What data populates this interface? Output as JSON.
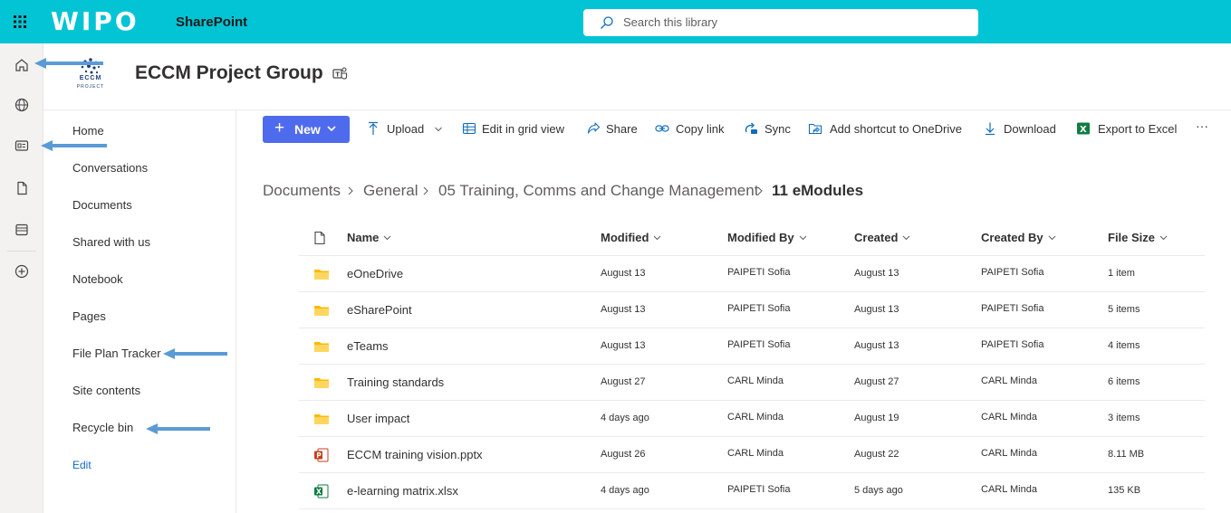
{
  "topbar": {
    "brand": "WIPO",
    "app_name": "SharePoint",
    "search_placeholder": "Search this library",
    "bg_color": "#03c4d4"
  },
  "rail": {
    "items": [
      {
        "icon": "home-icon"
      },
      {
        "icon": "globe-icon"
      },
      {
        "icon": "news-icon"
      },
      {
        "icon": "file-icon"
      },
      {
        "icon": "lists-icon"
      },
      {
        "icon": "add-icon"
      }
    ]
  },
  "site": {
    "title": "ECCM Project Group",
    "logo_text": "ECCM",
    "logo_subtext": "PROJECT"
  },
  "nav": {
    "items": [
      {
        "label": "Home"
      },
      {
        "label": "Conversations"
      },
      {
        "label": "Documents"
      },
      {
        "label": "Shared with us"
      },
      {
        "label": "Notebook"
      },
      {
        "label": "Pages"
      },
      {
        "label": "File Plan Tracker"
      },
      {
        "label": "Site contents"
      },
      {
        "label": "Recycle bin"
      }
    ],
    "edit_label": "Edit"
  },
  "commandbar": {
    "new_label": "New",
    "upload_label": "Upload",
    "edit_grid_label": "Edit in grid view",
    "share_label": "Share",
    "copy_link_label": "Copy link",
    "sync_label": "Sync",
    "add_shortcut_label": "Add shortcut to OneDrive",
    "download_label": "Download",
    "export_label": "Export to Excel",
    "more_label": "···",
    "accent_color": "#4f6bed"
  },
  "breadcrumb": {
    "items": [
      "Documents",
      "General",
      "05 Training, Comms and Change Management"
    ],
    "current": "11 eModules"
  },
  "table": {
    "columns": [
      "Name",
      "Modified",
      "Modified By",
      "Created",
      "Created By",
      "File Size"
    ],
    "rows": [
      {
        "type": "folder",
        "name": "eOneDrive",
        "modified": "August 13",
        "modified_by": "PAIPETI Sofia",
        "created": "August 13",
        "created_by": "PAIPETI Sofia",
        "size": "1 item"
      },
      {
        "type": "folder",
        "name": "eSharePoint",
        "modified": "August 13",
        "modified_by": "PAIPETI Sofia",
        "created": "August 13",
        "created_by": "PAIPETI Sofia",
        "size": "5 items"
      },
      {
        "type": "folder",
        "name": "eTeams",
        "modified": "August 13",
        "modified_by": "PAIPETI Sofia",
        "created": "August 13",
        "created_by": "PAIPETI Sofia",
        "size": "4 items"
      },
      {
        "type": "folder",
        "name": "Training standards",
        "modified": "August 27",
        "modified_by": "CARL Minda",
        "created": "August 27",
        "created_by": "CARL Minda",
        "size": "6 items"
      },
      {
        "type": "folder",
        "name": "User impact",
        "modified": "4 days ago",
        "modified_by": "CARL Minda",
        "created": "August 19",
        "created_by": "CARL Minda",
        "size": "3 items"
      },
      {
        "type": "pptx",
        "name": "ECCM training vision.pptx",
        "modified": "August 26",
        "modified_by": "CARL Minda",
        "created": "August 22",
        "created_by": "CARL Minda",
        "size": "8.11 MB"
      },
      {
        "type": "xlsx",
        "name": "e-learning matrix.xlsx",
        "modified": "4 days ago",
        "modified_by": "PAIPETI Sofia",
        "created": "5 days ago",
        "created_by": "CARL Minda",
        "size": "135 KB"
      }
    ]
  },
  "annotations": {
    "arrow_color": "#5b9bd5"
  }
}
